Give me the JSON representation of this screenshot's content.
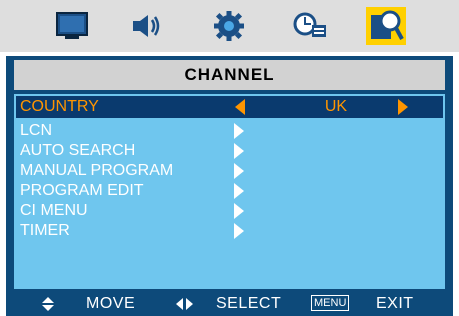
{
  "tabs": [
    {
      "icon": "picture-icon"
    },
    {
      "icon": "speaker-icon"
    },
    {
      "icon": "gear-icon"
    },
    {
      "icon": "clock-icon"
    },
    {
      "icon": "search-icon",
      "active": true
    }
  ],
  "header": {
    "title": "CHANNEL"
  },
  "menu": {
    "items": [
      {
        "label": "COUNTRY",
        "value": "UK",
        "selected": true
      },
      {
        "label": "LCN"
      },
      {
        "label": "AUTO SEARCH"
      },
      {
        "label": "MANUAL PROGRAM"
      },
      {
        "label": "PROGRAM EDIT"
      },
      {
        "label": "CI MENU"
      },
      {
        "label": "TIMER"
      }
    ]
  },
  "footer": {
    "move_label": "MOVE",
    "select_label": "SELECT",
    "menu_key": "MENU",
    "exit_label": "EXIT"
  },
  "colors": {
    "frame": "#0d4a7a",
    "panel": "#6fc6ee",
    "highlight": "#0a3a6e",
    "selected_text": "#ff9500",
    "active_tab": "#ffd000"
  }
}
